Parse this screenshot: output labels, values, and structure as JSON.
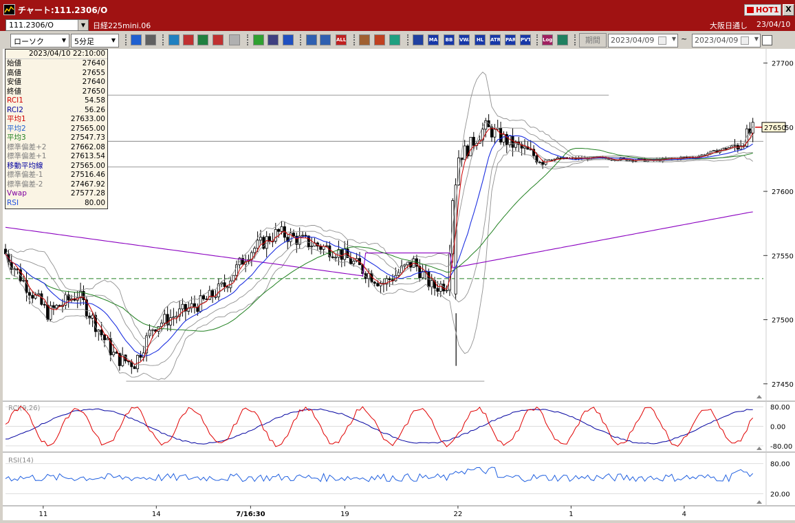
{
  "window": {
    "title": "チャート:111.2306/O",
    "hot_label": "HOT1",
    "close_label": "X"
  },
  "header": {
    "symbol_code": "111.2306/O",
    "instrument_name": "日経225mini.06",
    "session_label": "大阪日通し",
    "date_label": "23/04/10"
  },
  "toolbar": {
    "chart_type": "ローソク",
    "timeframe": "5分足",
    "buttons": [
      {
        "name": "zoom-icon",
        "label": "",
        "color": "#2060d0"
      },
      {
        "name": "crosshair-icon",
        "label": "",
        "color": "#606060"
      },
      {
        "name": "indicator-add-icon",
        "label": "",
        "color": "#2080c0"
      },
      {
        "name": "indicator-search-icon",
        "label": "",
        "color": "#c03030"
      },
      {
        "name": "indicator-chart-icon",
        "label": "",
        "color": "#208040"
      },
      {
        "name": "indicator-compare-icon",
        "label": "",
        "color": "#c03030"
      },
      {
        "name": "disabled-icon",
        "label": "",
        "color": "#b0b0b0"
      },
      {
        "name": "pen-draw-icon",
        "label": "",
        "color": "#30a030"
      },
      {
        "name": "cursor-icon",
        "label": "",
        "color": "#404080"
      },
      {
        "name": "undo-icon",
        "label": "",
        "color": "#2050c0"
      },
      {
        "name": "bar-narrow-icon",
        "label": "",
        "color": "#3060b0"
      },
      {
        "name": "bar-wide-icon",
        "label": "",
        "color": "#3060b0"
      },
      {
        "name": "all-button",
        "label": "ALL",
        "color": "#c02020"
      },
      {
        "name": "settings-icon",
        "label": "",
        "color": "#a06030"
      },
      {
        "name": "brush-icon",
        "label": "",
        "color": "#c04020"
      },
      {
        "name": "palette-icon",
        "label": "",
        "color": "#20a080"
      },
      {
        "name": "candle-toggle-icon",
        "label": "",
        "color": "#2040a0"
      },
      {
        "name": "ma-button",
        "label": "MA",
        "color": "#1838a8"
      },
      {
        "name": "bb-button",
        "label": "BB",
        "color": "#1838a8"
      },
      {
        "name": "vwap-button",
        "label": "VWAP",
        "color": "#1838a8"
      },
      {
        "name": "hl-button",
        "label": "HL",
        "color": "#1838a8"
      },
      {
        "name": "atr-button",
        "label": "ATR",
        "color": "#1838a8"
      },
      {
        "name": "parabolic-button",
        "label": "PAR",
        "color": "#1838a8"
      },
      {
        "name": "pvt-button",
        "label": "PVT",
        "color": "#1838a8"
      },
      {
        "name": "log-button",
        "label": "Log",
        "color": "#a02060"
      },
      {
        "name": "export-icon",
        "label": "",
        "color": "#208060"
      }
    ],
    "period_label": "期間",
    "date_from": "2023/04/09",
    "date_to": "2023/04/09",
    "range_sep": "~"
  },
  "info_panel": {
    "datetime": "2023/04/10  22:10:00",
    "rows": [
      {
        "label": "始値",
        "value": "27640",
        "color": "#000000"
      },
      {
        "label": "高値",
        "value": "27655",
        "color": "#000000"
      },
      {
        "label": "安値",
        "value": "27640",
        "color": "#000000"
      },
      {
        "label": "終値",
        "value": "27650",
        "color": "#000000"
      },
      {
        "label": "RCI1",
        "value": "54.58",
        "color": "#d00000"
      },
      {
        "label": "RCI2",
        "value": "56.26",
        "color": "#0000a0"
      },
      {
        "label": "平均1",
        "value": "27633.00",
        "color": "#d00000"
      },
      {
        "label": "平均2",
        "value": "27565.00",
        "color": "#2060d0"
      },
      {
        "label": "平均3",
        "value": "27547.73",
        "color": "#208020"
      },
      {
        "label": "標準偏差+2",
        "value": "27662.08",
        "color": "#808080"
      },
      {
        "label": "標準偏差+1",
        "value": "27613.54",
        "color": "#808080"
      },
      {
        "label": "移動平均線",
        "value": "27565.00",
        "color": "#0000a0"
      },
      {
        "label": "標準偏差-1",
        "value": "27516.46",
        "color": "#808080"
      },
      {
        "label": "標準偏差-2",
        "value": "27467.92",
        "color": "#808080"
      },
      {
        "label": "Vwap",
        "value": "27577.28",
        "color": "#8000a0"
      },
      {
        "label": "RSI",
        "value": "80.00",
        "color": "#2050e0"
      }
    ]
  },
  "chart_data": {
    "type": "candlestick",
    "y_axis_ticks": [
      "27700",
      "27650",
      "27600",
      "27550",
      "27500",
      "27450"
    ],
    "ylim": [
      27437,
      27710
    ],
    "last_price_label": "27650",
    "last_price": 27650,
    "x_axis_ticks": [
      "11",
      "14",
      "7/16:30",
      "19",
      "22",
      "1",
      "4"
    ],
    "x_axis_tick_positions": [
      11,
      14,
      16.5,
      19,
      22,
      25,
      28
    ],
    "xlim": [
      10.0,
      30.1
    ],
    "horizontal_lines": [
      27675,
      27639,
      27619
    ],
    "low_line": 27452,
    "dashed_line": 27532,
    "series_colors": {
      "candle": "#000000",
      "ma1": "#d00000",
      "ma2": "#1a2ee0",
      "ma3": "#208020",
      "bollinger": "#909090",
      "vwap": "#8a00c0",
      "rci1": "#e00000",
      "rci2": "#0000a0",
      "rsi": "#2060e0"
    },
    "rci_panel": {
      "title": "RCI(9,26)",
      "ticks": [
        "80.00",
        "0.00",
        "-80.00"
      ],
      "ylim": [
        -100,
        100
      ]
    },
    "rsi_panel": {
      "title": "RSI(14)",
      "ticks": [
        "80.00",
        "20.00"
      ],
      "ylim": [
        0,
        100
      ]
    }
  }
}
